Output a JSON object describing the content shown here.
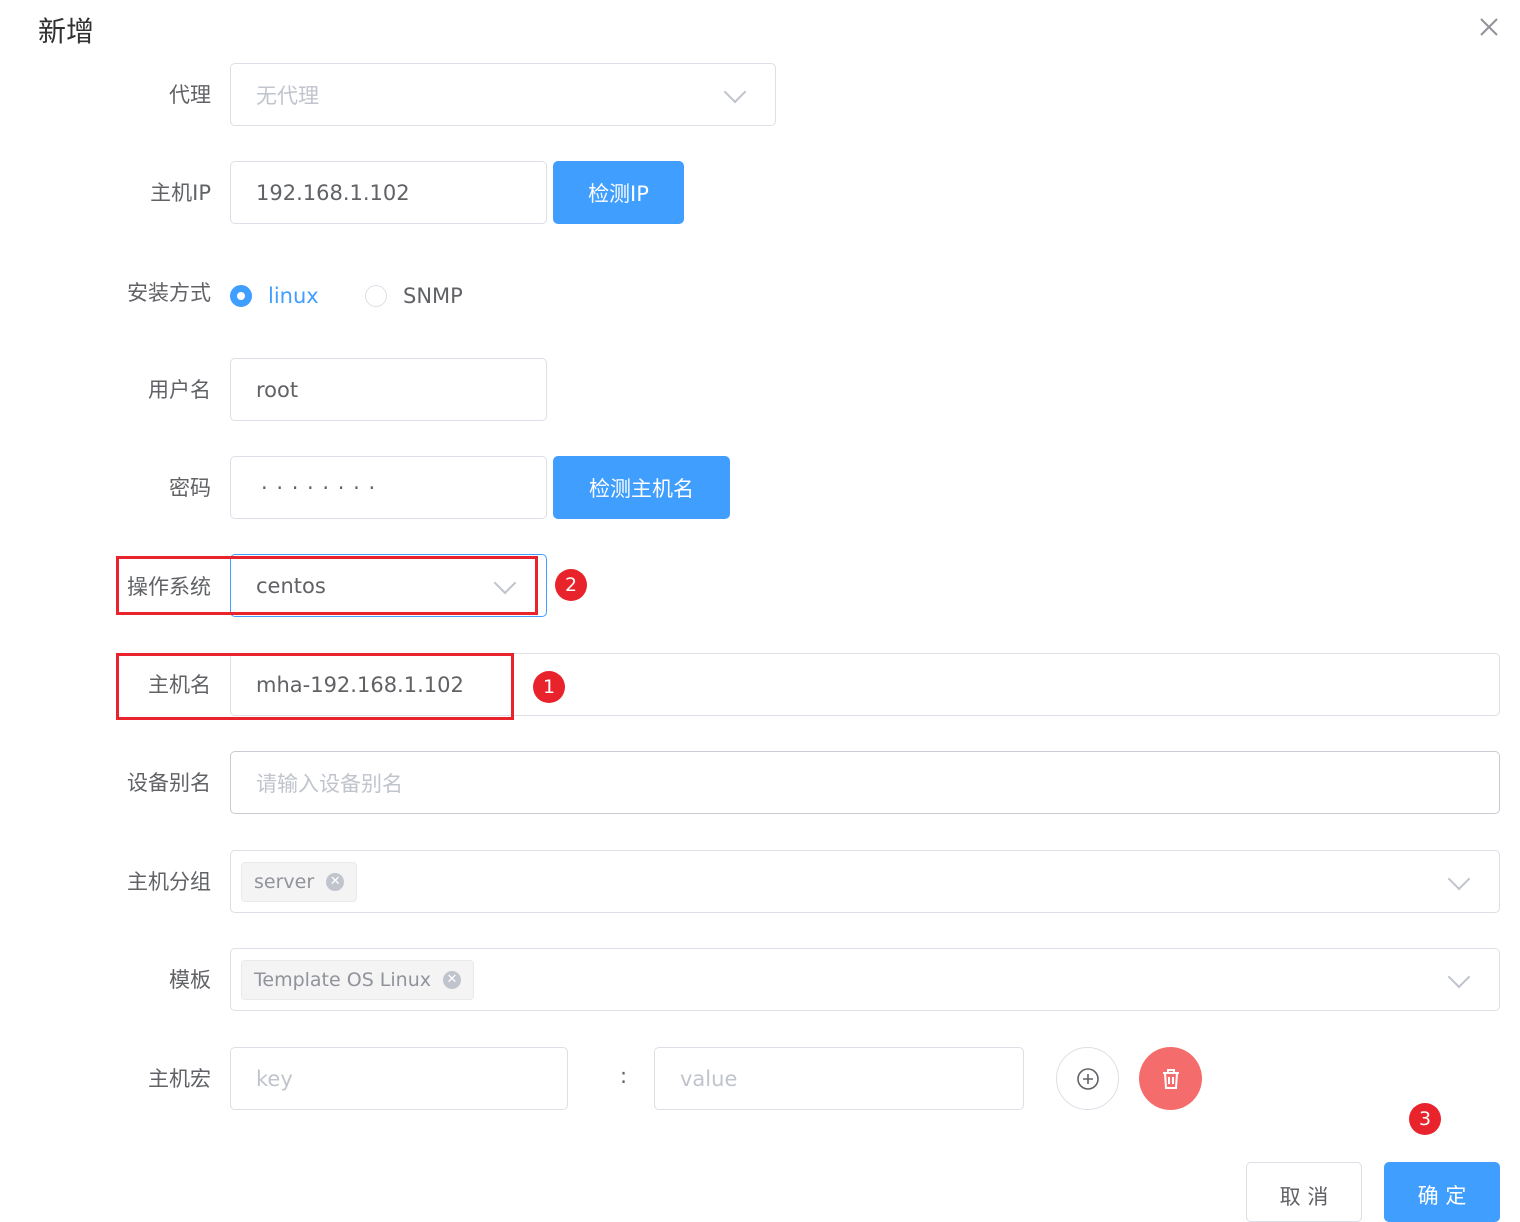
{
  "dialog": {
    "title": "新增",
    "close_icon": "close-icon"
  },
  "form": {
    "proxy": {
      "label": "代理",
      "placeholder": "无代理"
    },
    "host_ip": {
      "label": "主机IP",
      "value": "192.168.1.102",
      "button": "检测IP"
    },
    "install": {
      "label": "安装方式",
      "options": [
        "linux",
        "SNMP"
      ],
      "selected": "linux"
    },
    "username": {
      "label": "用户名",
      "value": "root"
    },
    "password": {
      "label": "密码",
      "value": "·  ·  ·  ·  ·  ·  ·  ·",
      "button": "检测主机名"
    },
    "os": {
      "label": "操作系统",
      "value": "centos"
    },
    "hostname": {
      "label": "主机名",
      "value": "mha-192.168.1.102"
    },
    "alias": {
      "label": "设备别名",
      "placeholder": "请输入设备别名"
    },
    "group": {
      "label": "主机分组",
      "tags": [
        "server"
      ]
    },
    "template": {
      "label": "模板",
      "tags": [
        "Template OS Linux"
      ]
    },
    "macro": {
      "label": "主机宏",
      "key_placeholder": "key",
      "separator": ":",
      "value_placeholder": "value"
    }
  },
  "annotations": {
    "badge1": "1",
    "badge2": "2",
    "badge3": "3"
  },
  "footer": {
    "cancel": "取 消",
    "confirm": "确 定"
  },
  "colors": {
    "primary": "#409eff",
    "danger": "#f56c6c",
    "annotation": "#e8232b"
  }
}
